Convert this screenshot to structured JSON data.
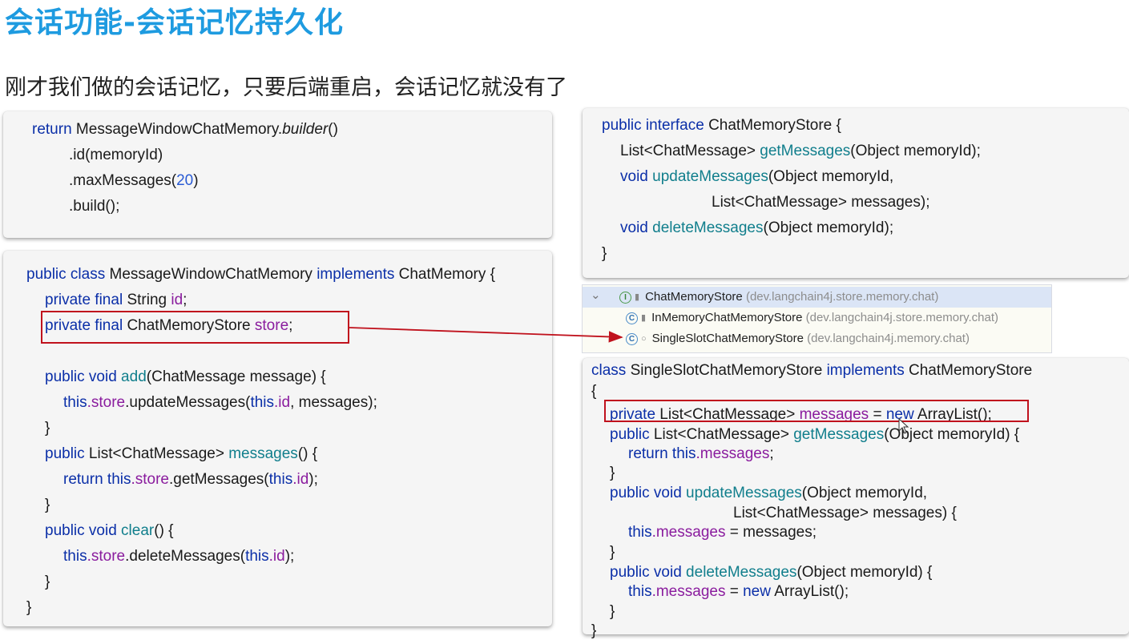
{
  "slide": {
    "title": "会话功能-会话记忆持久化",
    "subtitle": "刚才我们做的会话记忆，只要后端重启，会话记忆就没有了"
  },
  "builder_code": {
    "l1_return": "return",
    "l1_class": " MessageWindowChatMemory.",
    "l1_method": "builder",
    "l1_end": "()",
    "l2": ".id(memoryId)",
    "l3_a": ".maxMessages(",
    "l3_num": "20",
    "l3_b": ")",
    "l4": ".build();"
  },
  "window_memory_code": {
    "l1_kw": "public class",
    "l1_name": " MessageWindowChatMemory ",
    "l1_impl": "implements",
    "l1_rest": " ChatMemory {",
    "l2_kw": "private final",
    "l2_type": " String ",
    "l2_field": "id",
    "l2_end": ";",
    "l3_kw": "private final",
    "l3_type": " ChatMemoryStore ",
    "l3_field": "store",
    "l3_end": ";",
    "l4_kw": "public void",
    "l4_fn": " add",
    "l4_rest": "(ChatMessage message) {",
    "l5_this": "this",
    "l5_store": ".store",
    "l5_mid": ".updateMessages(",
    "l5_this2": "this",
    "l5_id": ".id",
    "l5_end": ", messages);",
    "l6": "}",
    "l7_kw": "public",
    "l7_type": " List<ChatMessage> ",
    "l7_fn": "messages",
    "l7_end": "() {",
    "l8_kw": "return this",
    "l8_store": ".store",
    "l8_mid": ".getMessages(",
    "l8_this": "this",
    "l8_id": ".id",
    "l8_end": ");",
    "l9": "}",
    "l10_kw": "public void",
    "l10_fn": " clear",
    "l10_end": "() {",
    "l11_this": "this",
    "l11_store": ".store",
    "l11_mid": ".deleteMessages(",
    "l11_this2": "this",
    "l11_id": ".id",
    "l11_end": ");",
    "l12": "}",
    "l13": "}"
  },
  "store_interface_code": {
    "l1_kw": "public interface",
    "l1_rest": " ChatMemoryStore {",
    "l2_type": "List<ChatMessage> ",
    "l2_fn": "getMessages",
    "l2_rest": "(Object memoryId);",
    "l3_kw": "void",
    "l3_fn": " updateMessages",
    "l3_rest": "(Object memoryId,",
    "l4": "List<ChatMessage> messages);",
    "l5_kw": "void",
    "l5_fn": " deleteMessages",
    "l5_rest": "(Object memoryId);",
    "l6": "}"
  },
  "hierarchy_tree": {
    "items": [
      {
        "name": "ChatMemoryStore",
        "package": "(dev.langchain4j.store.memory.chat)",
        "icon_letter": "I"
      },
      {
        "name": "InMemoryChatMemoryStore",
        "package": "(dev.langchain4j.store.memory.chat)",
        "icon_letter": "C"
      },
      {
        "name": "SingleSlotChatMemoryStore",
        "package": "(dev.langchain4j.memory.chat)",
        "icon_letter": "C"
      }
    ],
    "expander": "⌄"
  },
  "single_slot_code": {
    "l1_kw": "class",
    "l1_name": " SingleSlotChatMemoryStore ",
    "l1_impl": "implements",
    "l1_rest": " ChatMemoryStore",
    "l2": "{",
    "l3_kw": "private",
    "l3_type": " List<ChatMessage> ",
    "l3_field": "messages",
    "l3_eq": " = ",
    "l3_new": "new",
    "l3_end": " ArrayList();",
    "l4_kw": "public",
    "l4_type": " List<ChatMessage> ",
    "l4_fn": "getMessages",
    "l4_rest": "(Object memoryId) {",
    "l5_kw": "return this",
    "l5_field": ".messages",
    "l5_end": ";",
    "l6": "}",
    "l7_kw": "public void",
    "l7_fn": " updateMessages",
    "l7_rest": "(Object memoryId,",
    "l8": "List<ChatMessage> messages) {",
    "l9_this": "this",
    "l9_field": ".messages",
    "l9_end": " = messages;",
    "l10": "}",
    "l11_kw": "public void",
    "l11_fn": " deleteMessages",
    "l11_rest": "(Object memoryId) {",
    "l12_this": "this",
    "l12_field": ".messages",
    "l12_eq": " = ",
    "l12_new": "new",
    "l12_end": " ArrayList();",
    "l13": "}",
    "l14": "}"
  },
  "colors": {
    "title": "#1e9be0",
    "keyword": "#0b2fa8",
    "method": "#107e8c",
    "field": "#8a1c9e",
    "number": "#2a5bd4",
    "highlight_box": "#c0121d"
  }
}
